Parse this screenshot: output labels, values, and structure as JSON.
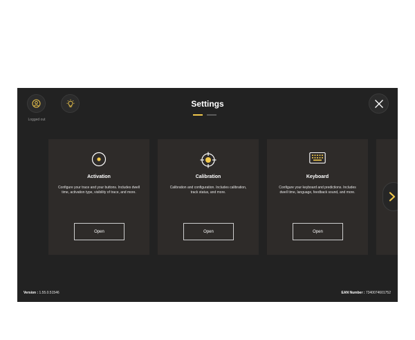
{
  "header": {
    "title": "Settings",
    "logged_out_label": "Logged out",
    "pager": {
      "pages": 2,
      "active": 0
    }
  },
  "icons": {
    "profile": "user-circle-icon",
    "light": "lightbulb-icon",
    "close": "close-icon",
    "next": "chevron-right-icon"
  },
  "cards": [
    {
      "icon": "activation-target-icon",
      "title": "Activation",
      "description": "Configure your trace and your buttons. Includes dwell time, activation type, visibility of trace, and more.",
      "button_label": "Open"
    },
    {
      "icon": "crosshair-icon",
      "title": "Calibration",
      "description": "Calibration and configuration. Includes calibration, track status, and more.",
      "button_label": "Open"
    },
    {
      "icon": "keyboard-icon",
      "title": "Keyboard",
      "description": "Configure your keyboard and predictions. Includes dwell time, language, feedback sound, and more.",
      "button_label": "Open"
    }
  ],
  "footer": {
    "version_label": "Version :",
    "version_value": "1.55.0.51546",
    "ean_label": "EAN Number :",
    "ean_value": "7340074601752"
  },
  "colors": {
    "accent": "#f2c94c",
    "background": "#222222",
    "card": "#2e2b29"
  }
}
